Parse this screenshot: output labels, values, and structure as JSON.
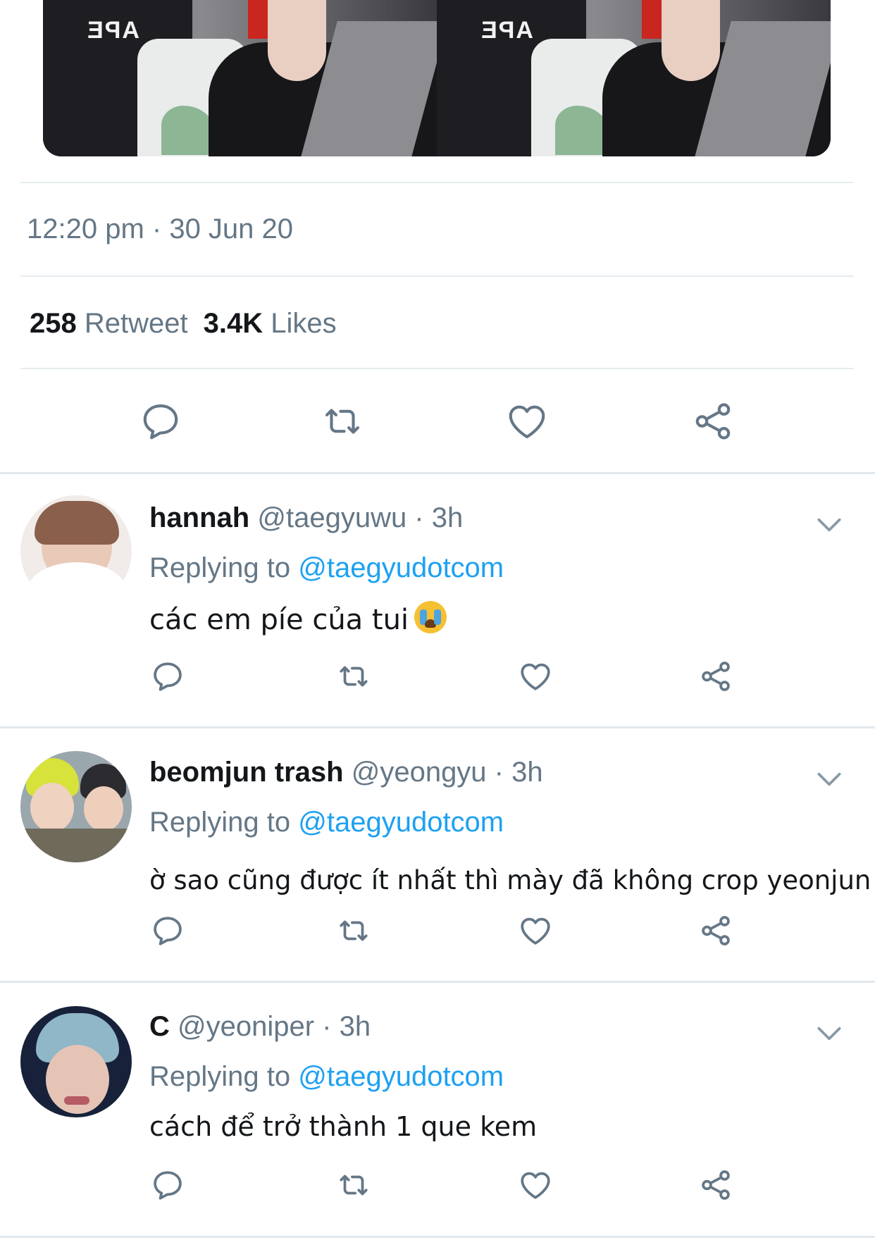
{
  "tweet": {
    "image_text": "APE",
    "timestamp": "12:20 pm · 30 Jun 20",
    "retweet_count": "258",
    "retweet_label": "Retweet",
    "like_count": "3.4K",
    "like_label": "Likes"
  },
  "icons": {
    "reply": "reply-icon",
    "retweet": "retweet-icon",
    "like": "heart-icon",
    "share": "share-icon",
    "more": "chevron-down-icon"
  },
  "colors": {
    "link": "#1da1f2",
    "secondary_text": "#657786",
    "primary_text": "#14171a",
    "divider": "#e6ecf0"
  },
  "replies": [
    {
      "display_name": "hannah",
      "meta": "@taegyuwu · 3h",
      "replying_prefix": "Replying to",
      "replying_handle": "@taegyudotcom",
      "text": "các em píe của tui",
      "emoji": "loudly-crying-face"
    },
    {
      "display_name": "beomjun trash",
      "meta": "@yeongyu · 3h",
      "replying_prefix": "Replying to",
      "replying_handle": "@taegyudotcom",
      "text": "ờ sao cũng được ít nhất thì mày đã không crop yeonjun"
    },
    {
      "display_name": "C",
      "meta": "@yeoniper · 3h",
      "replying_prefix": "Replying to",
      "replying_handle": "@taegyudotcom",
      "text": "cách để trở thành 1 que kem"
    }
  ]
}
